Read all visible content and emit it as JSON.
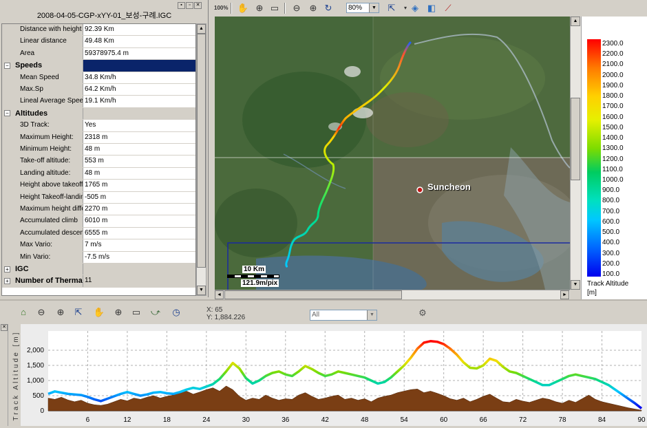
{
  "window": {
    "file_title": "2008-04-05-CGP-xYY-01_보성-구례.IGC",
    "win_buttons": [
      "▪",
      "▫",
      "✕"
    ]
  },
  "properties": [
    {
      "name": "Distance with height",
      "value": "92.39 Km"
    },
    {
      "name": "Linear distance",
      "value": "49.48 Km"
    },
    {
      "name": "Area",
      "value": "59378975.4 m"
    },
    {
      "group": true,
      "name": "Speeds",
      "expander": "−",
      "selected": true,
      "value": ""
    },
    {
      "name": "Mean Speed",
      "value": "34.8 Km/h"
    },
    {
      "name": "Max.Sp",
      "value": "64.2 Km/h"
    },
    {
      "name": "Lineal Average Speed",
      "value": "19.1 Km/h"
    },
    {
      "group": true,
      "name": "Altitudes",
      "expander": "−",
      "value": ""
    },
    {
      "name": "3D Track:",
      "value": "Yes"
    },
    {
      "name": "Maximum Height:",
      "value": "2318 m"
    },
    {
      "name": "Minimum Height:",
      "value": "48 m"
    },
    {
      "name": "Take-off altitude:",
      "value": "553 m"
    },
    {
      "name": "Landing altitude:",
      "value": "48 m"
    },
    {
      "name": "Height above takeoff",
      "value": "1765 m"
    },
    {
      "name": "Height Takeoff-landing",
      "value": "-505 m"
    },
    {
      "name": "Maximum height difference",
      "value": "2270 m"
    },
    {
      "name": "Accumulated climb",
      "value": "6010 m"
    },
    {
      "name": "Accumulated descent",
      "value": "6555 m"
    },
    {
      "name": "Max Vario:",
      "value": "7 m/s"
    },
    {
      "name": "Min Vario:",
      "value": "-7.5 m/s"
    },
    {
      "group": true,
      "name": "IGC",
      "expander": "+",
      "value": ""
    },
    {
      "group": true,
      "name": "Number of Thermals",
      "expander": "+",
      "value": "11"
    }
  ],
  "map_toolbar": {
    "zoom_value": "80%",
    "icons": [
      "zoom-100-icon",
      "hand-pan-icon",
      "zoom-window-icon",
      "select-icon",
      "zoom-out-icon",
      "zoom-in-icon",
      "refresh-icon",
      "fit-track-icon",
      "layers-icon",
      "export-icon",
      "measure-icon"
    ]
  },
  "map": {
    "city_label": "Suncheon",
    "scale_distance": "10 Km",
    "scale_resolution": "121.9m/pix"
  },
  "legend": {
    "title": "Track Altitude",
    "unit": "[m]",
    "ticks": [
      "2300.0",
      "2200.0",
      "2100.0",
      "2000.0",
      "1900.0",
      "1800.0",
      "1700.0",
      "1600.0",
      "1500.0",
      "1400.0",
      "1300.0",
      "1200.0",
      "1100.0",
      "1000.0",
      "900.0",
      "800.0",
      "700.0",
      "600.0",
      "500.0",
      "400.0",
      "300.0",
      "200.0",
      "100.0"
    ]
  },
  "profile_toolbar": {
    "cursor_x": "X: 65",
    "cursor_y": "Y: 1,884.226",
    "filter_value": "All"
  },
  "chart_data": {
    "type": "area",
    "xlabel": "",
    "ylabel": "Track Altitude [m]",
    "xlim": [
      0,
      90
    ],
    "ylim": [
      0,
      2500
    ],
    "x_ticks": [
      6,
      12,
      18,
      24,
      30,
      36,
      42,
      48,
      54,
      60,
      66,
      72,
      78,
      84,
      90
    ],
    "y_ticks": [
      "0",
      "500",
      "1,000",
      "1,500",
      "2,000"
    ],
    "grid": true,
    "series": [
      {
        "name": "Track Altitude",
        "x": [
          0,
          1,
          2,
          3,
          4,
          5,
          6,
          7,
          8,
          9,
          10,
          11,
          12,
          13,
          14,
          15,
          16,
          17,
          18,
          19,
          20,
          21,
          22,
          23,
          24,
          25,
          26,
          27,
          28,
          29,
          30,
          31,
          32,
          33,
          34,
          35,
          36,
          37,
          38,
          39,
          40,
          41,
          42,
          43,
          44,
          45,
          46,
          47,
          48,
          49,
          50,
          51,
          52,
          53,
          54,
          55,
          56,
          57,
          58,
          59,
          60,
          61,
          62,
          63,
          64,
          65,
          66,
          67,
          68,
          69,
          70,
          71,
          72,
          73,
          74,
          75,
          76,
          77,
          78,
          79,
          80,
          81,
          82,
          83,
          84,
          85,
          86,
          87,
          88,
          89,
          90
        ],
        "values": [
          560,
          640,
          600,
          560,
          540,
          520,
          460,
          380,
          320,
          400,
          480,
          560,
          620,
          560,
          500,
          540,
          600,
          620,
          580,
          560,
          620,
          700,
          760,
          720,
          800,
          880,
          1050,
          1300,
          1580,
          1400,
          1080,
          900,
          1000,
          1150,
          1250,
          1300,
          1200,
          1150,
          1300,
          1480,
          1380,
          1250,
          1150,
          1200,
          1300,
          1250,
          1200,
          1150,
          1100,
          1000,
          900,
          950,
          1100,
          1300,
          1500,
          1750,
          2050,
          2250,
          2300,
          2280,
          2200,
          2050,
          1850,
          1600,
          1420,
          1400,
          1500,
          1720,
          1650,
          1450,
          1300,
          1250,
          1150,
          1050,
          950,
          850,
          850,
          950,
          1050,
          1150,
          1200,
          1150,
          1100,
          1050,
          950,
          850,
          700,
          550,
          400,
          250,
          80
        ]
      },
      {
        "name": "Ground",
        "x": [
          0,
          1,
          2,
          3,
          4,
          5,
          6,
          7,
          8,
          9,
          10,
          11,
          12,
          13,
          14,
          15,
          16,
          17,
          18,
          19,
          20,
          21,
          22,
          23,
          24,
          25,
          26,
          27,
          28,
          29,
          30,
          31,
          32,
          33,
          34,
          35,
          36,
          37,
          38,
          39,
          40,
          41,
          42,
          43,
          44,
          45,
          46,
          47,
          48,
          49,
          50,
          51,
          52,
          53,
          54,
          55,
          56,
          57,
          58,
          59,
          60,
          61,
          62,
          63,
          64,
          65,
          66,
          67,
          68,
          69,
          70,
          71,
          72,
          73,
          74,
          75,
          76,
          77,
          78,
          79,
          80,
          81,
          82,
          83,
          84,
          85,
          86,
          87,
          88,
          89,
          90
        ],
        "values": [
          420,
          380,
          450,
          360,
          300,
          350,
          250,
          200,
          180,
          220,
          300,
          380,
          330,
          420,
          380,
          450,
          500,
          420,
          480,
          520,
          600,
          650,
          550,
          620,
          700,
          760,
          650,
          820,
          700,
          480,
          350,
          420,
          380,
          520,
          420,
          350,
          400,
          380,
          520,
          600,
          480,
          380,
          420,
          480,
          520,
          380,
          420,
          350,
          400,
          300,
          420,
          480,
          520,
          600,
          650,
          700,
          720,
          600,
          650,
          580,
          500,
          400,
          350,
          420,
          300,
          380,
          480,
          550,
          420,
          300,
          280,
          380,
          320,
          280,
          350,
          420,
          380,
          300,
          250,
          350,
          280,
          400,
          520,
          380,
          300,
          250,
          200,
          150,
          100,
          60,
          20
        ]
      }
    ]
  },
  "colors": {
    "selection": "#0a246a",
    "ground": "#7a3e14",
    "chrome": "#d4d0c8"
  }
}
